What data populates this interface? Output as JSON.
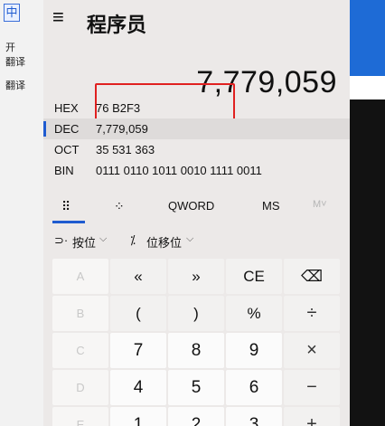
{
  "left_app": {
    "icon_char": "中",
    "line1": "开",
    "line2": "翻译",
    "line3": "翻译"
  },
  "calculator": {
    "title": "程序员",
    "display_value": "7,779,059",
    "radix": [
      {
        "label": "HEX",
        "value": "76 B2F3"
      },
      {
        "label": "DEC",
        "value": "7,779,059"
      },
      {
        "label": "OCT",
        "value": "35 531 363"
      },
      {
        "label": "BIN",
        "value": "0111 0110 1011 0010 1111 0011"
      }
    ],
    "mode_bar": {
      "word_size": "QWORD",
      "ms": "MS",
      "m": "M˅"
    },
    "ops": {
      "bitwise": "按位",
      "bitshift": "位移位"
    },
    "keys": [
      [
        "A",
        "«",
        "»",
        "CE",
        "⌫"
      ],
      [
        "B",
        "(",
        ")",
        "%",
        "÷"
      ],
      [
        "C",
        "7",
        "8",
        "9",
        "×"
      ],
      [
        "D",
        "4",
        "5",
        "6",
        "−"
      ],
      [
        "E",
        "1",
        "2",
        "3",
        "+"
      ]
    ]
  },
  "colors": {
    "accent": "#1f5bd0",
    "highlight_box": "#e02020",
    "window_bg": "#ece9e8"
  }
}
